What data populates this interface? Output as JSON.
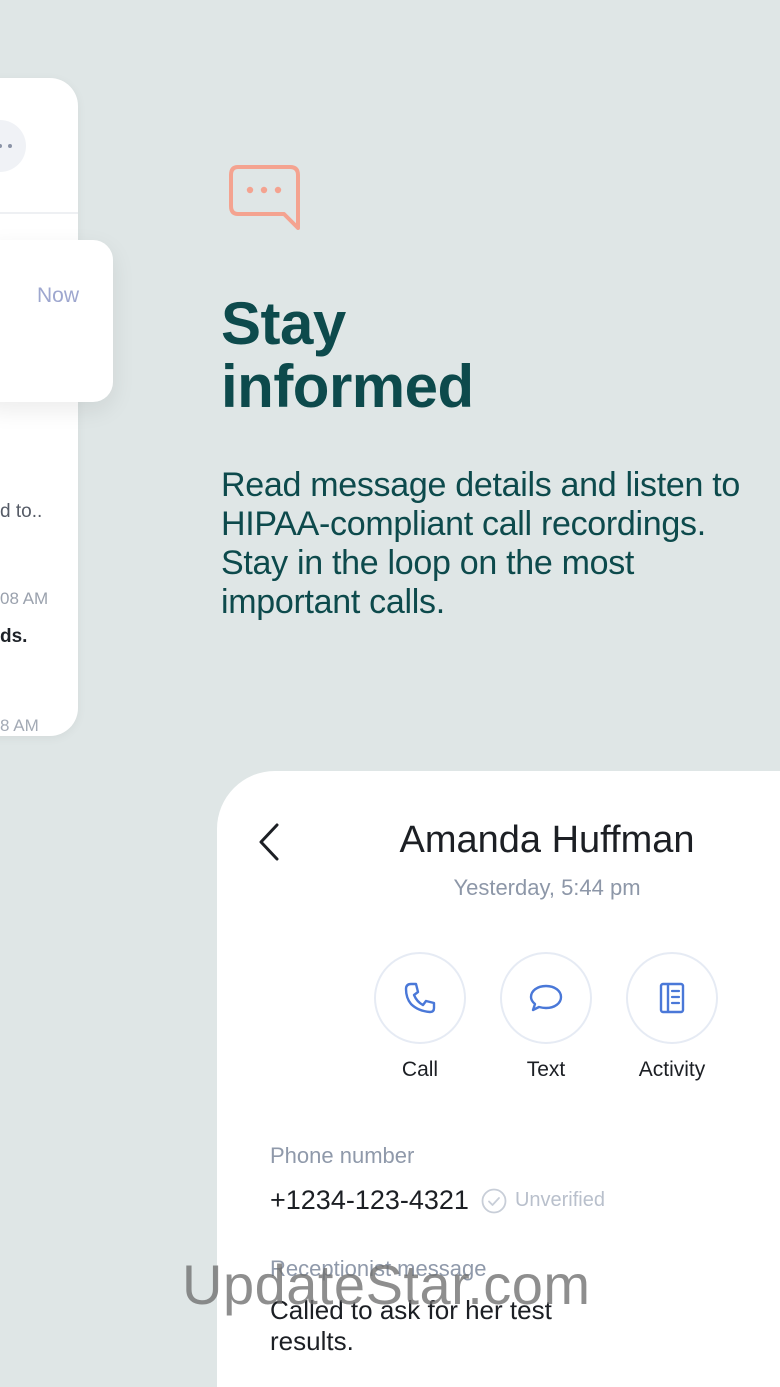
{
  "left_card": {
    "notification_time": "Now",
    "faint_text": "",
    "preview_text": "d to..",
    "row1_time": "08 AM",
    "row1_bold": "ds.",
    "row2_time": "8 AM"
  },
  "hero": {
    "icon": "chat-bubble-icon",
    "title_line1": "Stay",
    "title_line2": "informed",
    "subtitle": "Read message details and listen to HIPAA-compliant call recordings. Stay in the loop on the most important calls."
  },
  "contact": {
    "name": "Amanda Huffman",
    "time": "Yesterday, 5:44 pm",
    "actions": [
      {
        "label": "Call",
        "icon": "phone-icon"
      },
      {
        "label": "Text",
        "icon": "message-icon"
      },
      {
        "label": "Activity",
        "icon": "notebook-icon"
      }
    ],
    "phone_label": "Phone number",
    "phone_value": "+1234-123-4321",
    "verification": "Unverified",
    "message_label": "Receptionist message",
    "message_value": "Called to ask for her test results."
  },
  "watermark": "UpdateStar.com",
  "colors": {
    "background": "#dfe6e6",
    "headline": "#0d4a4c",
    "accent_icon": "#f4a390",
    "action_icon": "#4a78d8"
  }
}
